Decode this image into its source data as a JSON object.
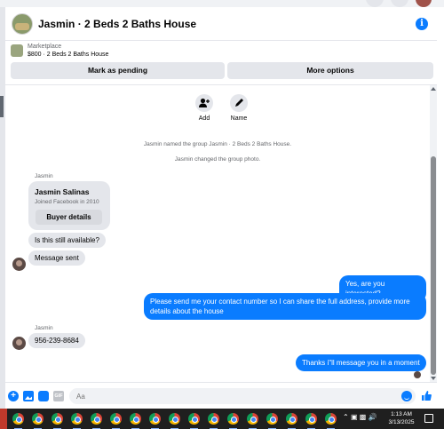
{
  "header": {
    "title": "Jasmin · 2 Beds 2 Baths House",
    "info_icon": "info-icon"
  },
  "marketplace": {
    "label": "Marketplace",
    "item": "$800 · 2 Beds 2 Baths House",
    "pending_button": "Mark as pending",
    "more_button": "More options"
  },
  "actions": {
    "add": "Add",
    "name": "Name"
  },
  "system_messages": [
    "Jasmin named the group Jasmin · 2 Beds 2 Baths House.",
    "Jasmin changed the group photo."
  ],
  "messages": {
    "sender1": "Jasmin",
    "card_name": "Jasmin Salinas",
    "card_sub": "Joined Facebook in 2010",
    "card_button": "Buyer details",
    "in1": "Is this still available?",
    "in2": "Message sent",
    "out1": "Yes, are you interested?",
    "out2": "Please send me your contact number so I can share the full address, provide more details about the house",
    "sender2": "Jasmin",
    "in3": "956-239-8684",
    "out3": "Thanks i\"ll message you in a moment"
  },
  "composer": {
    "placeholder": "Aa",
    "gif_label": "GIF"
  },
  "taskbar": {
    "time": "1:13 AM",
    "date": "3/13/2025",
    "app_count": 17
  },
  "colors": {
    "accent": "#0a7cff",
    "bubble_in": "#e4e6eb",
    "taskbar": "#1f1f1f"
  }
}
